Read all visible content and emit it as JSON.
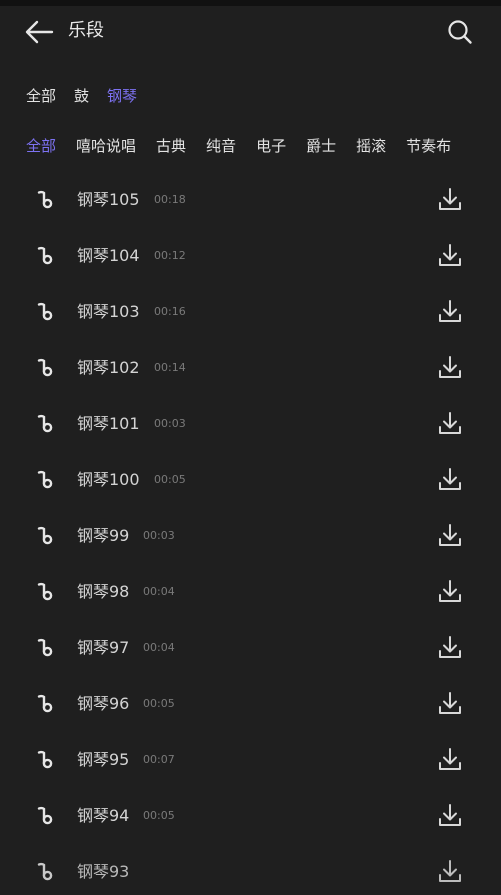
{
  "header": {
    "title": "乐段",
    "back_icon": "arrow-left-icon",
    "search_icon": "search-icon"
  },
  "category_tabs": [
    {
      "label": "全部",
      "active": false
    },
    {
      "label": "鼓",
      "active": false
    },
    {
      "label": "钢琴",
      "active": true
    }
  ],
  "sub_tabs": [
    {
      "label": "全部",
      "active": true
    },
    {
      "label": "嘻哈说唱",
      "active": false
    },
    {
      "label": "古典",
      "active": false
    },
    {
      "label": "纯音",
      "active": false
    },
    {
      "label": "电子",
      "active": false
    },
    {
      "label": "爵士",
      "active": false
    },
    {
      "label": "摇滚",
      "active": false
    },
    {
      "label": "节奏布",
      "active": false
    }
  ],
  "tracks": [
    {
      "name": "钢琴105",
      "duration": "00:18"
    },
    {
      "name": "钢琴104",
      "duration": "00:12"
    },
    {
      "name": "钢琴103",
      "duration": "00:16"
    },
    {
      "name": "钢琴102",
      "duration": "00:14"
    },
    {
      "name": "钢琴101",
      "duration": "00:03"
    },
    {
      "name": "钢琴100",
      "duration": "00:05"
    },
    {
      "name": "钢琴99",
      "duration": "00:03"
    },
    {
      "name": "钢琴98",
      "duration": "00:04"
    },
    {
      "name": "钢琴97",
      "duration": "00:04"
    },
    {
      "name": "钢琴96",
      "duration": "00:05"
    },
    {
      "name": "钢琴95",
      "duration": "00:07"
    },
    {
      "name": "钢琴94",
      "duration": "00:05"
    },
    {
      "name": "钢琴93",
      "duration": ""
    }
  ],
  "colors": {
    "background": "#1f1f1f",
    "accent": "#7d72f2",
    "text": "#e2e2e2",
    "muted": "#7a7a7a"
  }
}
